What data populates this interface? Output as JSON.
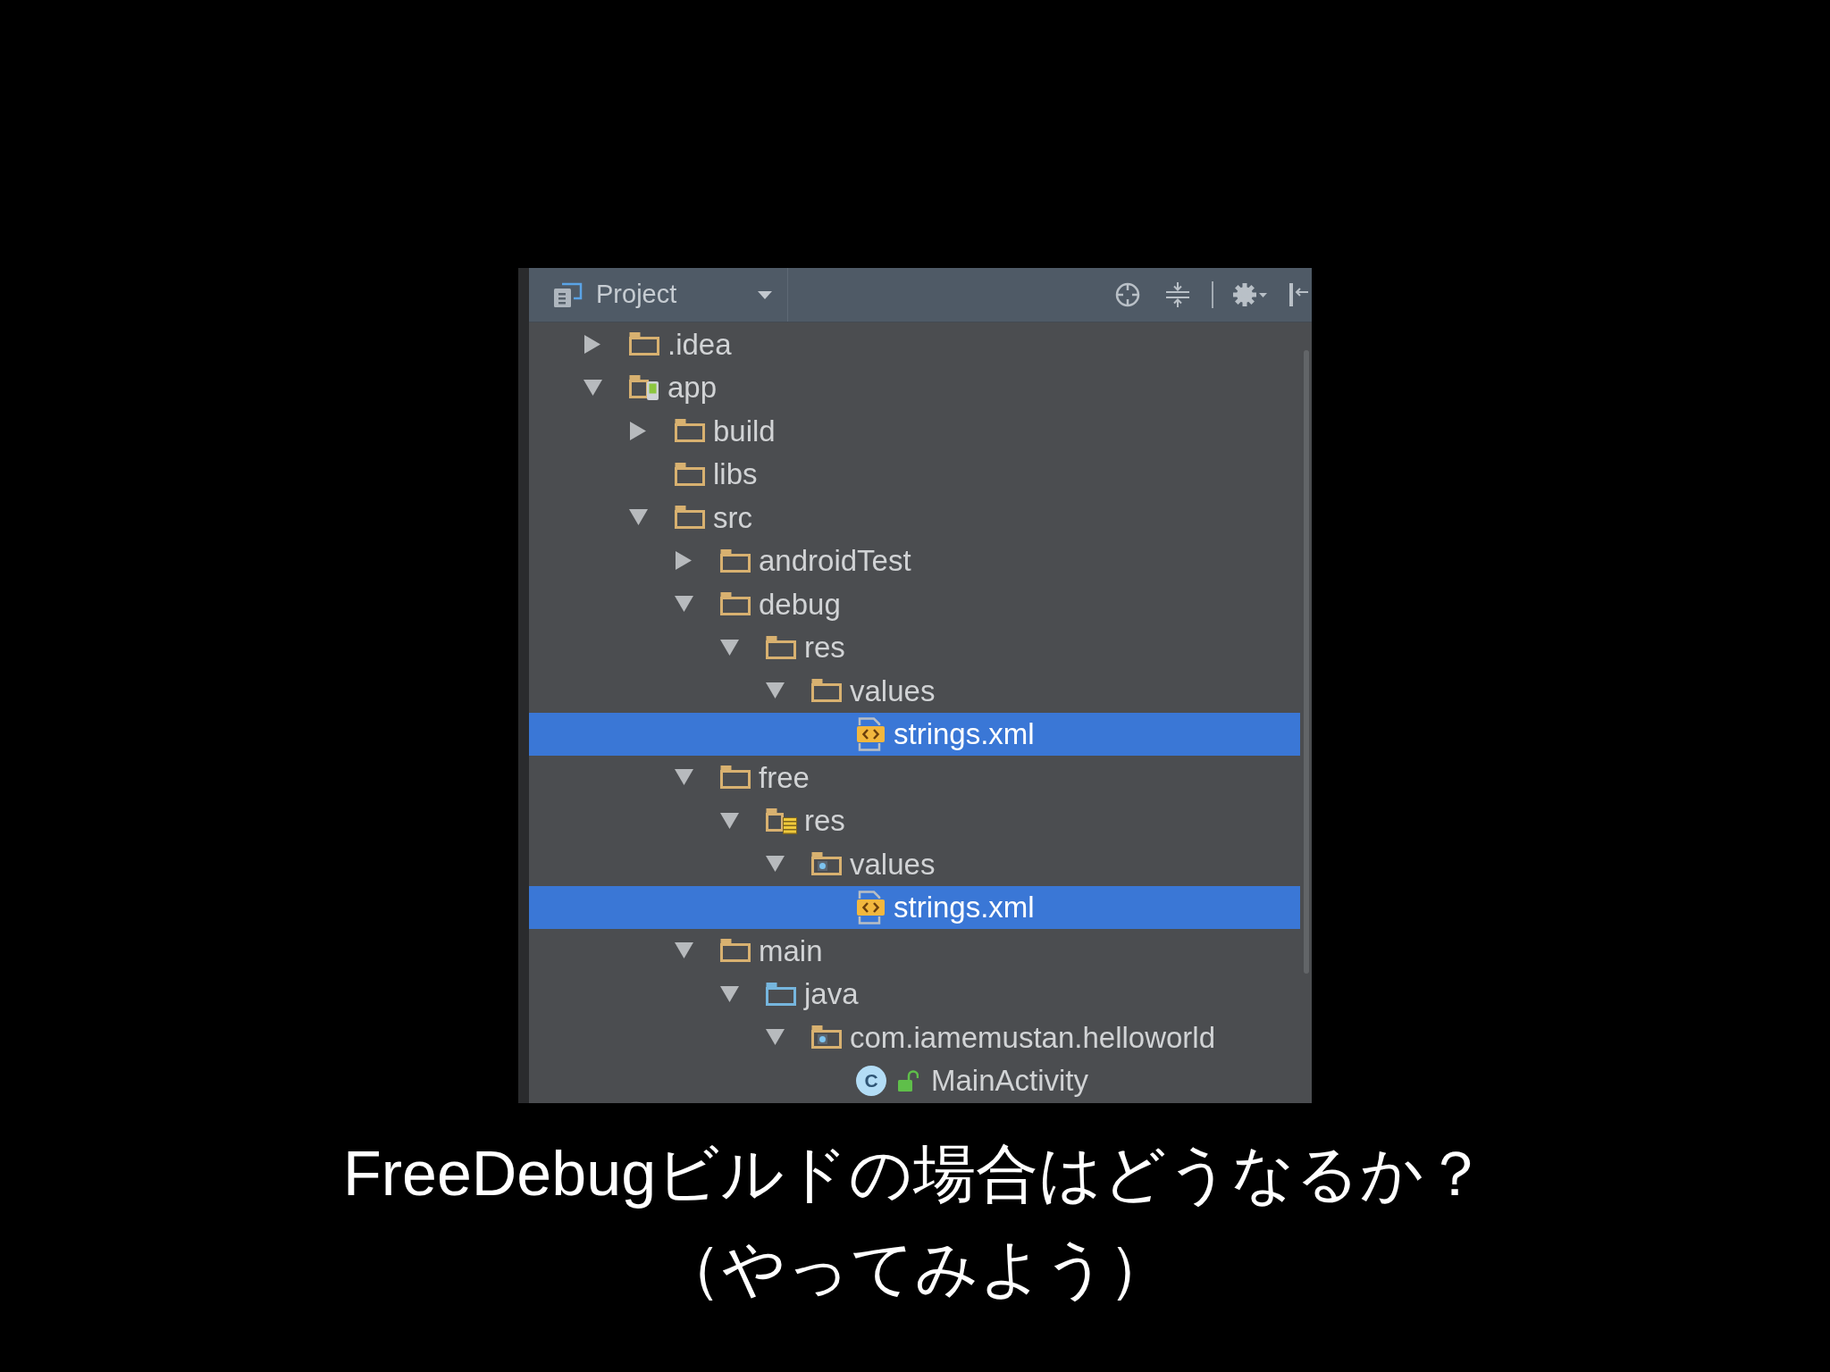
{
  "project_panel": {
    "title": "Project",
    "tree": [
      {
        "name": ".idea",
        "kind": "folder",
        "expanded": false,
        "selected": false
      },
      {
        "name": "app",
        "kind": "module",
        "expanded": true,
        "selected": false,
        "children": [
          {
            "name": "build",
            "kind": "folder",
            "expanded": false,
            "selected": false
          },
          {
            "name": "libs",
            "kind": "folder",
            "selected": false
          },
          {
            "name": "src",
            "kind": "folder",
            "expanded": true,
            "selected": false,
            "children": [
              {
                "name": "androidTest",
                "kind": "folder",
                "expanded": false,
                "selected": false
              },
              {
                "name": "debug",
                "kind": "folder",
                "expanded": true,
                "selected": false,
                "children": [
                  {
                    "name": "res",
                    "kind": "folder",
                    "expanded": true,
                    "selected": false,
                    "children": [
                      {
                        "name": "values",
                        "kind": "folder",
                        "expanded": true,
                        "selected": false,
                        "children": [
                          {
                            "name": "strings.xml",
                            "kind": "xml-file",
                            "selected": true
                          }
                        ]
                      }
                    ]
                  }
                ]
              },
              {
                "name": "free",
                "kind": "folder",
                "expanded": true,
                "selected": false,
                "children": [
                  {
                    "name": "res",
                    "kind": "resource-folder",
                    "expanded": true,
                    "selected": false,
                    "children": [
                      {
                        "name": "values",
                        "kind": "package-folder",
                        "expanded": true,
                        "selected": false,
                        "children": [
                          {
                            "name": "strings.xml",
                            "kind": "xml-file",
                            "selected": true
                          }
                        ]
                      }
                    ]
                  }
                ]
              },
              {
                "name": "main",
                "kind": "folder",
                "expanded": true,
                "selected": false,
                "children": [
                  {
                    "name": "java",
                    "kind": "source-folder",
                    "expanded": true,
                    "selected": false,
                    "children": [
                      {
                        "name": "com.iamemustan.helloworld",
                        "kind": "package-folder",
                        "expanded": true,
                        "selected": false,
                        "children": [
                          {
                            "name": "MainActivity",
                            "kind": "class",
                            "badge": "C",
                            "selected": false
                          }
                        ]
                      }
                    ]
                  }
                ]
              }
            ]
          }
        ]
      }
    ]
  },
  "caption": [
    "FreeDebugビルドの場合はどうなるか？",
    "（やってみよう）"
  ]
}
